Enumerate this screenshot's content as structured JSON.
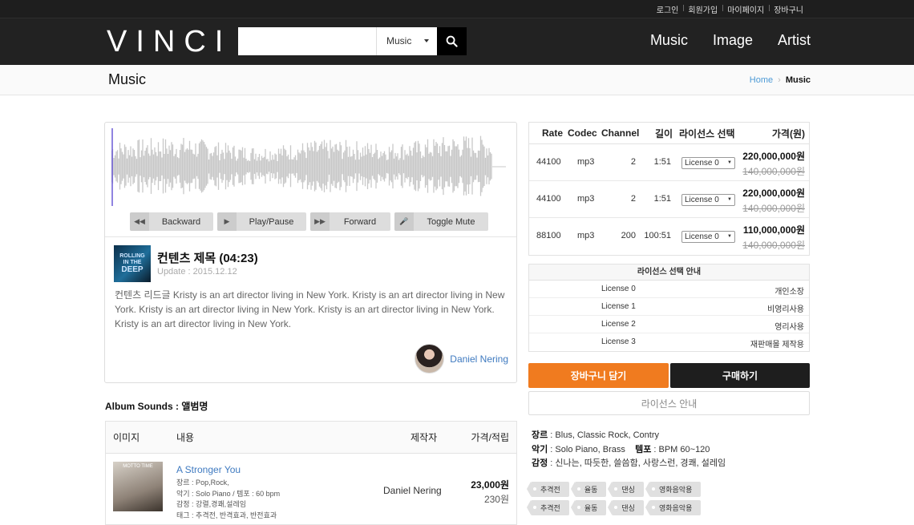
{
  "utility_links": [
    "로그인",
    "회원가입",
    "마이페이지",
    "장바구니"
  ],
  "header": {
    "logo": "VINCI",
    "search": {
      "value": "",
      "placeholder": "",
      "category": "Music"
    },
    "nav": [
      "Music",
      "Image",
      "Artist"
    ]
  },
  "page": {
    "title": "Music",
    "breadcrumb": {
      "home": "Home",
      "current": "Music"
    }
  },
  "player": {
    "controls": [
      "Backward",
      "Play/Pause",
      "Forward",
      "Toggle Mute"
    ],
    "cover_text": [
      "ROLLING",
      "IN THE",
      "DEEP"
    ],
    "title": "컨텐츠 제목 (04:23)",
    "update": "Update : 2015.12.12",
    "description": "컨텐츠 리드글 Kristy is an art director living in New York. Kristy is an art director living in New York. Kristy is an art director living in New York. Kristy is an art director living in New York. Kristy is an art director living in New York.",
    "author": "Daniel Nering"
  },
  "album": {
    "title": "Album Sounds : 앨범명",
    "headers": {
      "image": "이미지",
      "content": "내용",
      "artist": "제작자",
      "price": "가격/적립"
    },
    "rows": [
      {
        "cover_text": "MOTTO TIME",
        "title": "A Stronger You",
        "genre": "장르 : Pop,Rock,",
        "instrument": "악기 : Solo Piano / 템포 : 60 bpm",
        "emotion": "감정 : 강렬,경쾌,설레임",
        "tags": "태그 : 추격전, 반격효과, 반전효과",
        "artist": "Daniel Nering",
        "price": "23,000원",
        "points": "230원"
      }
    ]
  },
  "licenses": {
    "headers": {
      "rate": "Rate",
      "codec": "Codec",
      "channel": "Channel",
      "length": "길이",
      "select": "라이선스 선택",
      "price": "가격(원)"
    },
    "rows": [
      {
        "rate": "44100",
        "codec": "mp3",
        "channel": "2",
        "length": "1:51",
        "license": "License 0",
        "price": "220,000,000원",
        "old_price": "140,000,000원"
      },
      {
        "rate": "44100",
        "codec": "mp3",
        "channel": "2",
        "length": "1:51",
        "license": "License 0",
        "price": "220,000,000원",
        "old_price": "140,000,000원"
      },
      {
        "rate": "88100",
        "codec": "mp3",
        "channel": "200",
        "length": "100:51",
        "license": "License 0",
        "price": "110,000,000원",
        "old_price": "140,000,000원"
      }
    ]
  },
  "license_guide": {
    "title": "라이선스 선택 안내",
    "rows": [
      {
        "license": "License 0",
        "usage": "개인소장"
      },
      {
        "license": "License 1",
        "usage": "비영리사용"
      },
      {
        "license": "License 2",
        "usage": "영리사용"
      },
      {
        "license": "License 3",
        "usage": "재판매몰 제작용"
      }
    ]
  },
  "actions": {
    "cart": "장바구니 담기",
    "buy": "구매하기",
    "guide": "라이선스 안내"
  },
  "info": {
    "genre_label": "장르",
    "genre": " : Blus, Classic Rock, Contry",
    "instrument_label": "악기",
    "instrument": " : Solo Piano, Brass",
    "tempo_label": "템포",
    "tempo": " : BPM 60~120",
    "emotion_label": "감정",
    "emotion": " : 신나는, 따듯한, 쓸씀함, 사랑스런, 경쾌, 설레임"
  },
  "tags": [
    [
      "추격전",
      "율동",
      "댄싱",
      "영화음악용"
    ],
    [
      "추격전",
      "율동",
      "댄싱",
      "영화음악용"
    ]
  ],
  "colors": {
    "accent_orange": "#f07b1f",
    "header_dark": "#222222",
    "link_blue": "#3f7ac0"
  }
}
